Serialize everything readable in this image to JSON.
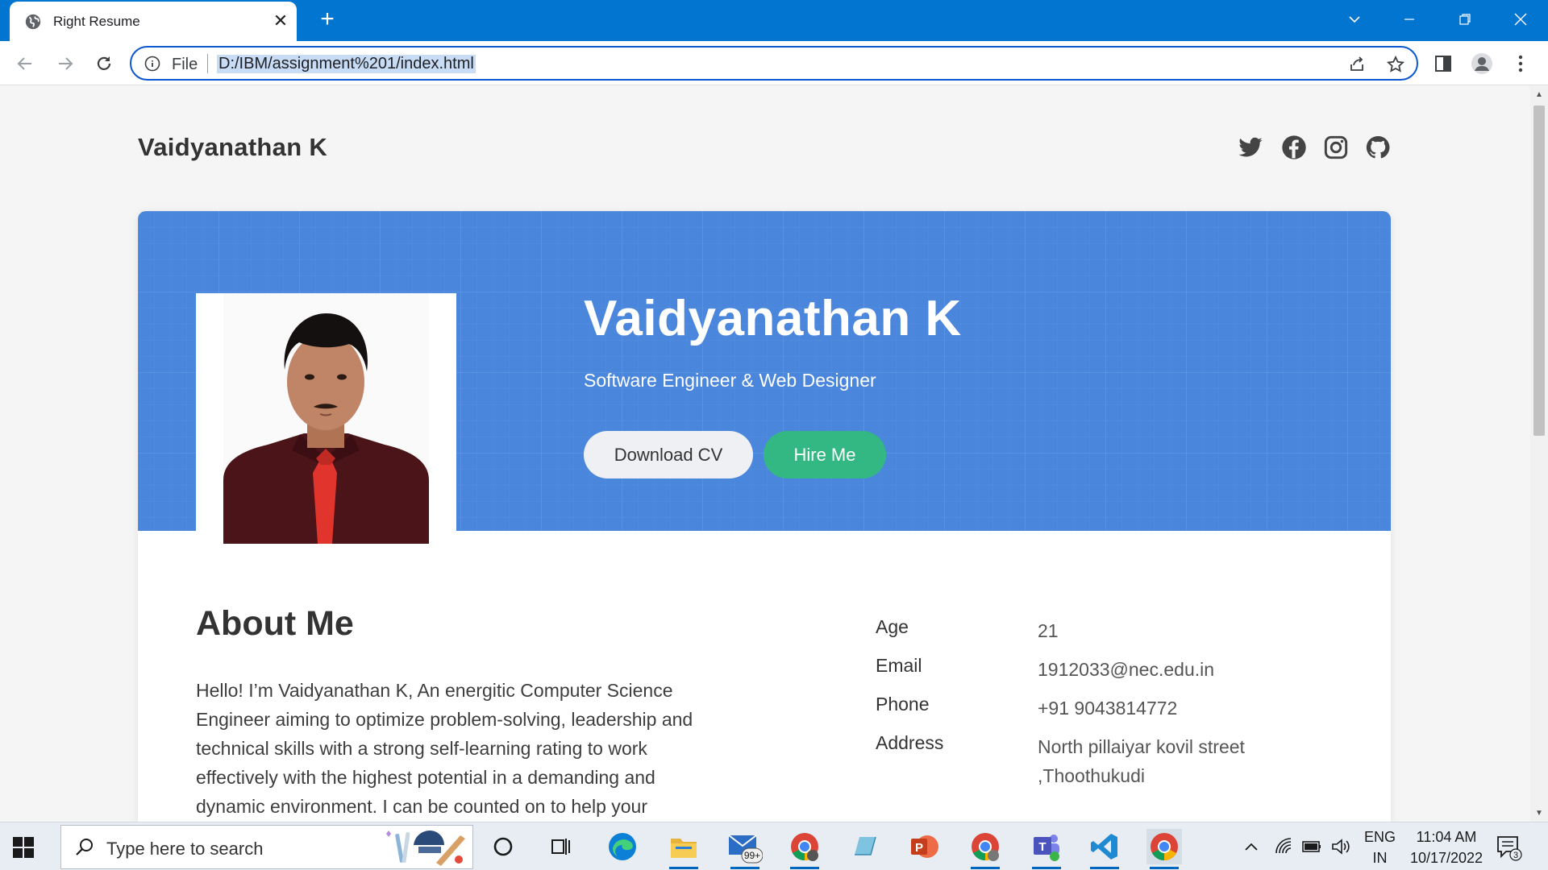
{
  "browser": {
    "tab_title": "Right Resume",
    "tab_close": "✕",
    "new_tab": "+",
    "file_label": "File",
    "url": "D:/IBM/assignment%201/index.html"
  },
  "site": {
    "brand": "Vaidyanathan K",
    "social_icons": [
      "twitter-icon",
      "facebook-icon",
      "instagram-icon",
      "github-icon"
    ]
  },
  "hero": {
    "name": "Vaidyanathan K",
    "role": "Software Engineer & Web Designer",
    "download_label": "Download CV",
    "hire_label": "Hire Me"
  },
  "about": {
    "title": "About Me",
    "text": "Hello! I’m Vaidyanathan K, An energitic Computer Science Engineer aiming to optimize problem-solving, leadership and technical skills with a strong self-learning rating to work effectively with the highest potential in a demanding and dynamic environment. I can be counted on to help your",
    "info": [
      {
        "key": "Age",
        "value": "21"
      },
      {
        "key": "Email",
        "value": "1912033@nec.edu.in"
      },
      {
        "key": "Phone",
        "value": "+91 9043814772"
      },
      {
        "key": "Address",
        "value": "North pillaiyar kovil street ,Thoothukudi"
      }
    ]
  },
  "taskbar": {
    "search_placeholder": "Type here to search",
    "mail_badge": "99+",
    "lang_top": "ENG",
    "lang_bottom": "IN",
    "time": "11:04 AM",
    "date": "10/17/2022",
    "notifications": "3"
  },
  "colors": {
    "titlebar": "#0275d1",
    "hero_bg": "#4a86dc",
    "hire_button": "#33b883"
  }
}
